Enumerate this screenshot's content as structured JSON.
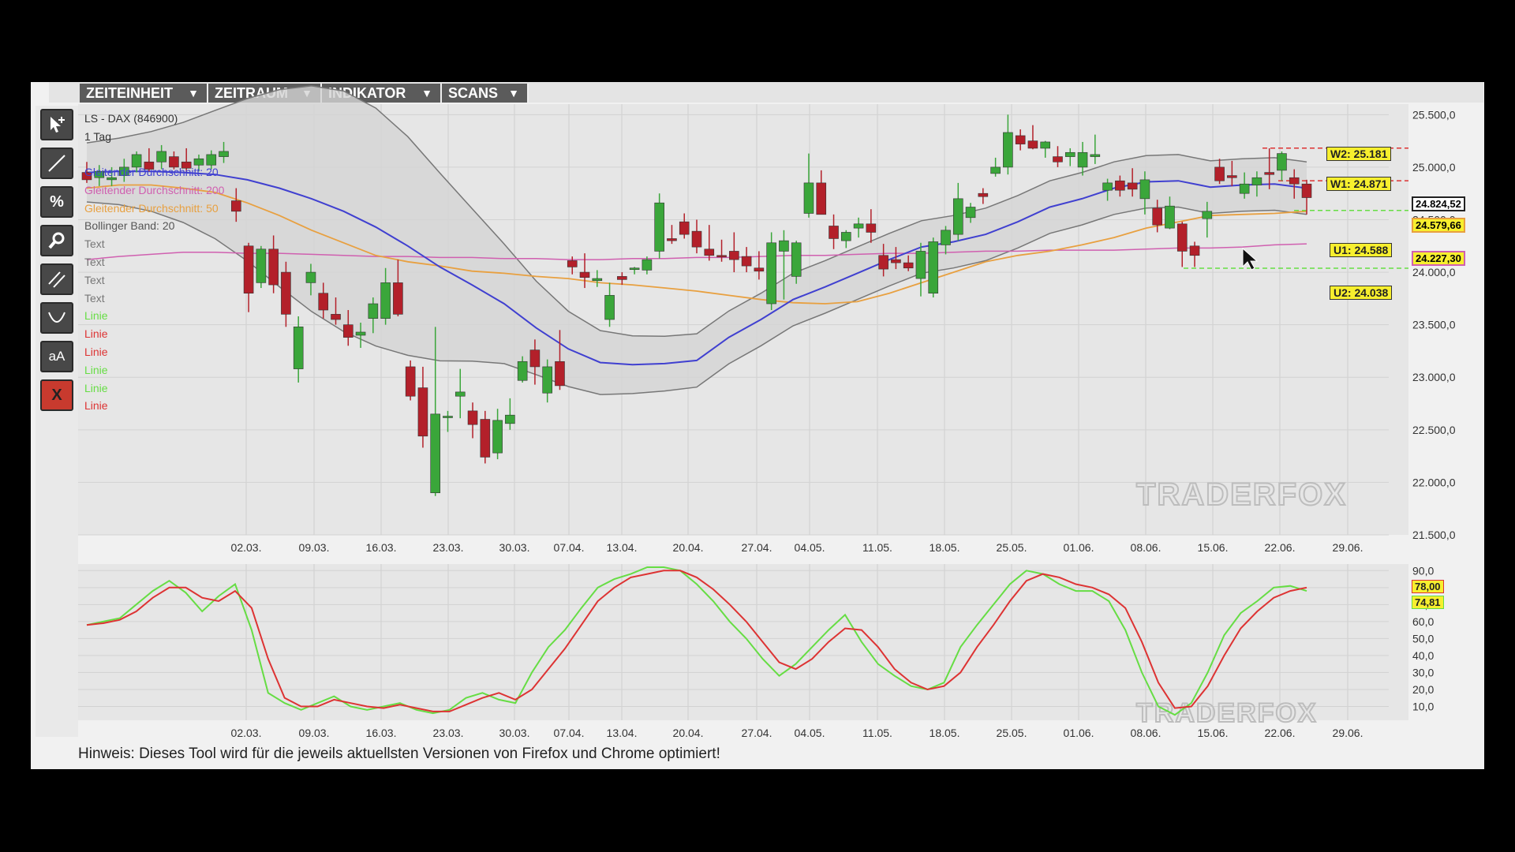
{
  "menu": [
    {
      "label": "ZEITEINHEIT"
    },
    {
      "label": "ZEITRAUM"
    },
    {
      "label": "INDIKATOR"
    },
    {
      "label": "SCANS"
    }
  ],
  "menu_arrow": "▼",
  "toolbar": {
    "icons": [
      "cursor-add-icon",
      "line-icon",
      "percent-icon",
      "zoom-icon",
      "parallel-lines-icon",
      "curve-icon",
      "text-size-icon",
      "delete-icon"
    ],
    "text_tool_label": "aA",
    "delete_label": "X",
    "percent_label": "%"
  },
  "chart": {
    "symbol": "LS - DAX (846900)",
    "timeframe": "1 Tag",
    "legend": [
      {
        "label": "Gleitender Durchschnitt: 20",
        "color": "#4040d0"
      },
      {
        "label": "Gleitender Durchschnitt: 200",
        "color": "#d060b0"
      },
      {
        "label": "Gleitender Durchschnitt: 50",
        "color": "#e8a040"
      },
      {
        "label": "Bollinger Band: 20",
        "color": "#555555"
      },
      {
        "label": "Text",
        "color": "#777777"
      },
      {
        "label": "Text",
        "color": "#777777"
      },
      {
        "label": "Text",
        "color": "#777777"
      },
      {
        "label": "Text",
        "color": "#777777"
      },
      {
        "label": "Linie",
        "color": "#66dd44"
      },
      {
        "label": "Linie",
        "color": "#dd3333"
      },
      {
        "label": "Linie",
        "color": "#dd3333"
      },
      {
        "label": "Linie",
        "color": "#66dd44"
      },
      {
        "label": "Linie",
        "color": "#66dd44"
      },
      {
        "label": "Linie",
        "color": "#dd3333"
      }
    ],
    "watermark": "TRADERFOX",
    "levels": [
      {
        "label": "W2: 25.181"
      },
      {
        "label": "W1: 24.871"
      },
      {
        "label": "U1: 24.588"
      },
      {
        "label": "U2: 24.038"
      }
    ],
    "price_tags": [
      {
        "label": "24.824,52",
        "bg": "#ffffff",
        "border": "#222222",
        "color": "#111111"
      },
      {
        "label": "24.579,66",
        "bg": "#f7ef2e",
        "border": "#e8a040",
        "color": "#111111"
      },
      {
        "label": "24.227,30",
        "bg": "#f7ef2e",
        "border": "#d060b0",
        "color": "#111111"
      }
    ]
  },
  "chart_data": [
    {
      "type": "candlestick",
      "title": "LS - DAX (846900)",
      "x_dates": [
        "02.03.",
        "09.03.",
        "16.03.",
        "23.03.",
        "30.03.",
        "07.04.",
        "13.04.",
        "20.04.",
        "27.04.",
        "04.05.",
        "11.05.",
        "18.05.",
        "25.05.",
        "01.06.",
        "08.06.",
        "15.06.",
        "22.06.",
        "29.06."
      ],
      "y_ticks": [
        "25.500,0",
        "25.000,0",
        "24.500,0",
        "24.000,0",
        "23.500,0",
        "23.000,0",
        "22.500,0",
        "22.000,0",
        "21.500,0"
      ],
      "ylim": [
        21500,
        25600
      ],
      "candles": [
        {
          "o": 24950,
          "h": 25050,
          "l": 24850,
          "c": 24880
        },
        {
          "o": 24900,
          "h": 25020,
          "l": 24820,
          "c": 24960
        },
        {
          "o": 24880,
          "h": 25000,
          "l": 24820,
          "c": 24900
        },
        {
          "o": 24920,
          "h": 25080,
          "l": 24860,
          "c": 25000
        },
        {
          "o": 25000,
          "h": 25150,
          "l": 24950,
          "c": 25120
        },
        {
          "o": 25050,
          "h": 25180,
          "l": 24960,
          "c": 24980
        },
        {
          "o": 25050,
          "h": 25210,
          "l": 24980,
          "c": 25150
        },
        {
          "o": 25100,
          "h": 25150,
          "l": 24980,
          "c": 25000
        },
        {
          "o": 25050,
          "h": 25180,
          "l": 24950,
          "c": 24990
        },
        {
          "o": 25020,
          "h": 25120,
          "l": 24960,
          "c": 25080
        },
        {
          "o": 25020,
          "h": 25160,
          "l": 24980,
          "c": 25120
        },
        {
          "o": 25100,
          "h": 25240,
          "l": 25040,
          "c": 25150
        },
        {
          "o": 24680,
          "h": 24800,
          "l": 24480,
          "c": 24580
        },
        {
          "o": 24250,
          "h": 24280,
          "l": 23620,
          "c": 23800
        },
        {
          "o": 23900,
          "h": 24250,
          "l": 23850,
          "c": 24220
        },
        {
          "o": 24220,
          "h": 24350,
          "l": 23800,
          "c": 23880
        },
        {
          "o": 24000,
          "h": 24100,
          "l": 23480,
          "c": 23600
        },
        {
          "o": 23080,
          "h": 23580,
          "l": 22950,
          "c": 23480
        },
        {
          "o": 23900,
          "h": 24080,
          "l": 23780,
          "c": 24000
        },
        {
          "o": 23800,
          "h": 23900,
          "l": 23560,
          "c": 23640
        },
        {
          "o": 23600,
          "h": 23760,
          "l": 23500,
          "c": 23550
        },
        {
          "o": 23500,
          "h": 23640,
          "l": 23300,
          "c": 23380
        },
        {
          "o": 23400,
          "h": 23520,
          "l": 23280,
          "c": 23430
        },
        {
          "o": 23560,
          "h": 23760,
          "l": 23420,
          "c": 23700
        },
        {
          "o": 23560,
          "h": 24040,
          "l": 23500,
          "c": 23900
        },
        {
          "o": 23900,
          "h": 24120,
          "l": 23580,
          "c": 23600
        },
        {
          "o": 23100,
          "h": 23160,
          "l": 22780,
          "c": 22820
        },
        {
          "o": 22900,
          "h": 23100,
          "l": 22330,
          "c": 22440
        },
        {
          "o": 21900,
          "h": 23480,
          "l": 21870,
          "c": 22650
        },
        {
          "o": 22620,
          "h": 22680,
          "l": 22480,
          "c": 22630
        },
        {
          "o": 22820,
          "h": 23080,
          "l": 22610,
          "c": 22860
        },
        {
          "o": 22680,
          "h": 22760,
          "l": 22420,
          "c": 22550
        },
        {
          "o": 22600,
          "h": 22680,
          "l": 22180,
          "c": 22240
        },
        {
          "o": 22280,
          "h": 22700,
          "l": 22220,
          "c": 22590
        },
        {
          "o": 22560,
          "h": 22800,
          "l": 22500,
          "c": 22640
        },
        {
          "o": 22970,
          "h": 23200,
          "l": 22950,
          "c": 23150
        },
        {
          "o": 23260,
          "h": 23360,
          "l": 22930,
          "c": 23100
        },
        {
          "o": 22850,
          "h": 23170,
          "l": 22760,
          "c": 23100
        },
        {
          "o": 23150,
          "h": 23450,
          "l": 22880,
          "c": 22920
        },
        {
          "o": 24110,
          "h": 24150,
          "l": 23980,
          "c": 24050
        },
        {
          "o": 24000,
          "h": 24180,
          "l": 23850,
          "c": 23950
        },
        {
          "o": 23920,
          "h": 24020,
          "l": 23860,
          "c": 23940
        },
        {
          "o": 23550,
          "h": 23900,
          "l": 23480,
          "c": 23780
        },
        {
          "o": 23960,
          "h": 24000,
          "l": 23880,
          "c": 23930
        },
        {
          "o": 24030,
          "h": 24050,
          "l": 23980,
          "c": 24040
        },
        {
          "o": 24020,
          "h": 24150,
          "l": 23980,
          "c": 24120
        },
        {
          "o": 24200,
          "h": 24750,
          "l": 24130,
          "c": 24660
        },
        {
          "o": 24320,
          "h": 24450,
          "l": 24270,
          "c": 24300
        },
        {
          "o": 24480,
          "h": 24560,
          "l": 24320,
          "c": 24360
        },
        {
          "o": 24390,
          "h": 24500,
          "l": 24180,
          "c": 24240
        },
        {
          "o": 24220,
          "h": 24450,
          "l": 24110,
          "c": 24160
        },
        {
          "o": 24160,
          "h": 24310,
          "l": 24100,
          "c": 24150
        },
        {
          "o": 24200,
          "h": 24380,
          "l": 24000,
          "c": 24120
        },
        {
          "o": 24150,
          "h": 24240,
          "l": 24000,
          "c": 24060
        },
        {
          "o": 24040,
          "h": 24200,
          "l": 23930,
          "c": 24010
        },
        {
          "o": 23700,
          "h": 24380,
          "l": 23640,
          "c": 24280
        },
        {
          "o": 24200,
          "h": 24400,
          "l": 23740,
          "c": 24300
        },
        {
          "o": 23960,
          "h": 24300,
          "l": 23890,
          "c": 24280
        },
        {
          "o": 24560,
          "h": 25130,
          "l": 24520,
          "c": 24850
        },
        {
          "o": 24850,
          "h": 24970,
          "l": 24730,
          "c": 24550
        },
        {
          "o": 24440,
          "h": 24550,
          "l": 24220,
          "c": 24320
        },
        {
          "o": 24300,
          "h": 24400,
          "l": 24230,
          "c": 24380
        },
        {
          "o": 24420,
          "h": 24520,
          "l": 24330,
          "c": 24460
        },
        {
          "o": 24460,
          "h": 24600,
          "l": 24280,
          "c": 24380
        },
        {
          "o": 24160,
          "h": 24270,
          "l": 23960,
          "c": 24030
        },
        {
          "o": 24120,
          "h": 24240,
          "l": 24030,
          "c": 24090
        },
        {
          "o": 24090,
          "h": 24160,
          "l": 24010,
          "c": 24040
        },
        {
          "o": 23940,
          "h": 24280,
          "l": 23770,
          "c": 24200
        },
        {
          "o": 23800,
          "h": 24330,
          "l": 23760,
          "c": 24290
        },
        {
          "o": 24260,
          "h": 24440,
          "l": 24170,
          "c": 24400
        },
        {
          "o": 24360,
          "h": 24850,
          "l": 24300,
          "c": 24700
        },
        {
          "o": 24520,
          "h": 24660,
          "l": 24470,
          "c": 24620
        },
        {
          "o": 24750,
          "h": 24800,
          "l": 24650,
          "c": 24720
        },
        {
          "o": 24940,
          "h": 25090,
          "l": 24910,
          "c": 25000
        },
        {
          "o": 25000,
          "h": 25500,
          "l": 24930,
          "c": 25330
        },
        {
          "o": 25300,
          "h": 25360,
          "l": 25160,
          "c": 25220
        },
        {
          "o": 25250,
          "h": 25400,
          "l": 25170,
          "c": 25180
        },
        {
          "o": 25180,
          "h": 25250,
          "l": 25090,
          "c": 25240
        },
        {
          "o": 25100,
          "h": 25200,
          "l": 25000,
          "c": 25050
        },
        {
          "o": 25100,
          "h": 25180,
          "l": 25010,
          "c": 25140
        },
        {
          "o": 25000,
          "h": 25240,
          "l": 24920,
          "c": 25140
        },
        {
          "o": 25100,
          "h": 25310,
          "l": 25030,
          "c": 25120
        },
        {
          "o": 24780,
          "h": 24890,
          "l": 24680,
          "c": 24850
        },
        {
          "o": 24870,
          "h": 24920,
          "l": 24720,
          "c": 24780
        },
        {
          "o": 24850,
          "h": 24990,
          "l": 24720,
          "c": 24790
        },
        {
          "o": 24700,
          "h": 24960,
          "l": 24550,
          "c": 24880
        },
        {
          "o": 24610,
          "h": 24690,
          "l": 24380,
          "c": 24450
        },
        {
          "o": 24420,
          "h": 24720,
          "l": 24410,
          "c": 24630
        },
        {
          "o": 24460,
          "h": 24480,
          "l": 24050,
          "c": 24200
        },
        {
          "o": 24250,
          "h": 24290,
          "l": 24050,
          "c": 24160
        },
        {
          "o": 24510,
          "h": 24670,
          "l": 24330,
          "c": 24580
        },
        {
          "o": 25000,
          "h": 25080,
          "l": 24840,
          "c": 24870
        },
        {
          "o": 24920,
          "h": 25060,
          "l": 24820,
          "c": 24900
        },
        {
          "o": 24750,
          "h": 24950,
          "l": 24700,
          "c": 24840
        },
        {
          "o": 24830,
          "h": 24960,
          "l": 24720,
          "c": 24900
        },
        {
          "o": 24950,
          "h": 25180,
          "l": 24790,
          "c": 24930
        },
        {
          "o": 24970,
          "h": 25150,
          "l": 24870,
          "c": 25130
        },
        {
          "o": 24900,
          "h": 24980,
          "l": 24700,
          "c": 24840
        },
        {
          "o": 24840,
          "h": 24880,
          "l": 24550,
          "c": 24710
        }
      ],
      "series": [
        {
          "name": "Gleitender Durchschnitt: 20",
          "color": "#4040d0",
          "values": [
            24950,
            24960,
            24960,
            24950,
            24930,
            24880,
            24800,
            24700,
            24580,
            24430,
            24250,
            24050,
            23880,
            23700,
            23470,
            23270,
            23140,
            23120,
            23130,
            23160,
            23380,
            23550,
            23740,
            23860,
            23990,
            24120,
            24240,
            24290,
            24360,
            24480,
            24620,
            24700,
            24800,
            24860,
            24870,
            24810,
            24830,
            24840,
            24800
          ]
        },
        {
          "name": "Gleitender Durchschnitt: 200",
          "color": "#d060b0",
          "values": [
            24120,
            24150,
            24170,
            24190,
            24190,
            24180,
            24180,
            24170,
            24160,
            24150,
            24150,
            24140,
            24140,
            24130,
            24130,
            24120,
            24120,
            24130,
            24130,
            24140,
            24140,
            24150,
            24160,
            24160,
            24170,
            24180,
            24180,
            24190,
            24200,
            24200,
            24210,
            24210,
            24210,
            24220,
            24230,
            24230,
            24240,
            24260,
            24270
          ]
        },
        {
          "name": "Gleitender Durchschnitt: 50",
          "color": "#e8a040",
          "values": [
            24800,
            24830,
            24830,
            24800,
            24760,
            24660,
            24540,
            24400,
            24280,
            24160,
            24100,
            24060,
            24010,
            23990,
            23960,
            23940,
            23900,
            23880,
            23850,
            23820,
            23780,
            23740,
            23710,
            23700,
            23720,
            23800,
            23900,
            24000,
            24100,
            24160,
            24200,
            24260,
            24330,
            24420,
            24480,
            24540,
            24550,
            24560,
            24580
          ]
        }
      ]
    },
    {
      "type": "line",
      "x_dates": [
        "02.03.",
        "09.03.",
        "16.03.",
        "23.03.",
        "30.03.",
        "07.04.",
        "13.04.",
        "20.04.",
        "27.04.",
        "04.05.",
        "11.05.",
        "18.05.",
        "25.05.",
        "01.06.",
        "08.06.",
        "15.06.",
        "22.06.",
        "29.06."
      ],
      "y_ticks": [
        "90,0",
        "80,0",
        "70,0",
        "60,0",
        "50,0",
        "40,0",
        "30,0",
        "20,0",
        "10,0"
      ],
      "ylim": [
        0,
        92
      ],
      "series": [
        {
          "name": "%K",
          "color": "#66dd44",
          "values": [
            58,
            60,
            62,
            70,
            78,
            84,
            77,
            66,
            75,
            82,
            55,
            18,
            12,
            8,
            12,
            16,
            10,
            8,
            10,
            12,
            8,
            6,
            8,
            15,
            18,
            14,
            12,
            30,
            45,
            55,
            68,
            80,
            85,
            88,
            92,
            92,
            90,
            82,
            72,
            60,
            50,
            38,
            28,
            35,
            45,
            55,
            64,
            48,
            35,
            28,
            22,
            20,
            24,
            45,
            58,
            70,
            82,
            90,
            88,
            82,
            78,
            78,
            72,
            55,
            30,
            10,
            5,
            12,
            30,
            52,
            65,
            72,
            80,
            81,
            78
          ]
        },
        {
          "name": "%D",
          "color": "#dd3333",
          "values": [
            58,
            59,
            61,
            66,
            74,
            80,
            80,
            74,
            72,
            78,
            68,
            38,
            15,
            10,
            10,
            14,
            12,
            10,
            9,
            11,
            9,
            7,
            7,
            11,
            15,
            18,
            14,
            20,
            32,
            44,
            58,
            72,
            80,
            86,
            88,
            90,
            90,
            86,
            79,
            70,
            60,
            48,
            36,
            32,
            38,
            48,
            56,
            55,
            45,
            32,
            24,
            20,
            22,
            30,
            45,
            58,
            72,
            84,
            88,
            86,
            82,
            80,
            76,
            68,
            48,
            24,
            9,
            10,
            22,
            40,
            56,
            66,
            74,
            78,
            80
          ]
        }
      ],
      "price_tags": [
        {
          "label": "78,00",
          "bg": "#f7ef2e",
          "border": "#dd3333"
        },
        {
          "label": "74,81",
          "bg": "#f7ef2e",
          "border": "#66dd44"
        }
      ]
    }
  ],
  "footer": {
    "hint": "Hinweis: Dieses Tool wird für die jeweils aktuellsten Versionen von Firefox und Chrome optimiert!"
  }
}
